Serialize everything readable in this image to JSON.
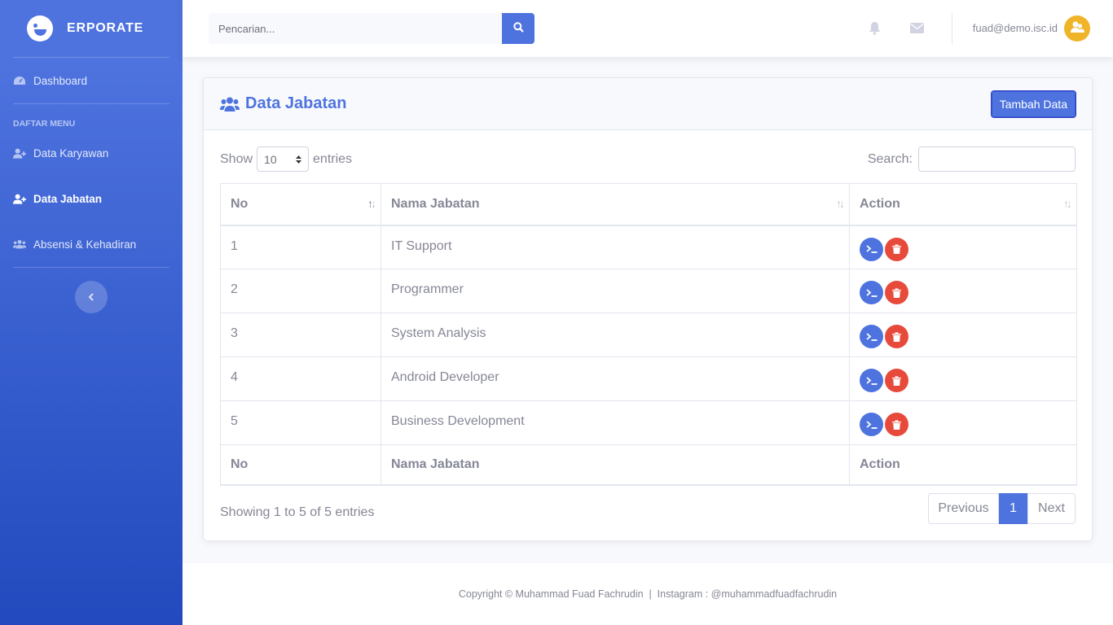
{
  "brand": {
    "name": "ERPORATE"
  },
  "sidebar": {
    "dashboard": "Dashboard",
    "heading": "DAFTAR MENU",
    "items": [
      {
        "label": "Data Karyawan",
        "icon": "user-plus-icon"
      },
      {
        "label": "Data Jabatan",
        "icon": "user-plus-icon",
        "active": true
      },
      {
        "label": "Absensi & Kehadiran",
        "icon": "users-icon"
      }
    ]
  },
  "topbar": {
    "search_placeholder": "Pencarian...",
    "user_email": "fuad@demo.isc.id"
  },
  "card": {
    "title": "Data Jabatan",
    "add_button": "Tambah Data"
  },
  "datatable": {
    "show_label": "Show",
    "length_value": "10",
    "entries_label": "entries",
    "search_label": "Search:",
    "columns": [
      "No",
      "Nama Jabatan",
      "Action"
    ],
    "rows": [
      {
        "no": "1",
        "nama": "IT Support"
      },
      {
        "no": "2",
        "nama": "Programmer"
      },
      {
        "no": "3",
        "nama": "System Analysis"
      },
      {
        "no": "4",
        "nama": "Android Developer"
      },
      {
        "no": "5",
        "nama": "Business Development"
      }
    ],
    "info": "Showing 1 to 5 of 5 entries",
    "pagination": {
      "previous": "Previous",
      "current": "1",
      "next": "Next"
    }
  },
  "footer": {
    "text": "Copyright © Muhammad Fuad Fachrudin  |  Instagram : @muhammadfuadfachrudin"
  },
  "colors": {
    "primary": "#4e73df",
    "danger": "#e74a3b",
    "avatar": "#f0b429"
  }
}
